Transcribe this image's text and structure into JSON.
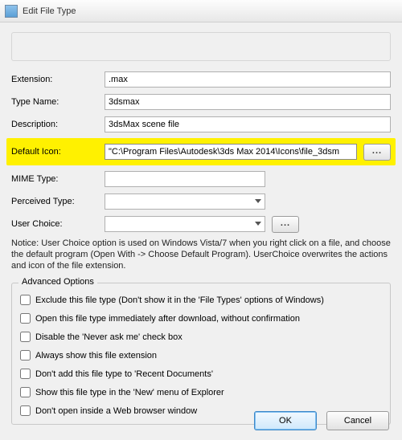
{
  "window": {
    "title": "Edit File Type"
  },
  "fields": {
    "extension": {
      "label": "Extension:",
      "value": ".max"
    },
    "typeName": {
      "label": "Type Name:",
      "value": "3dsmax"
    },
    "description": {
      "label": "Description:",
      "value": "3dsMax scene file"
    },
    "defaultIcon": {
      "label": "Default Icon:",
      "value": "\"C:\\Program Files\\Autodesk\\3ds Max 2014\\Icons\\file_3dsm",
      "browse": "..."
    },
    "mimeType": {
      "label": "MIME Type:",
      "value": ""
    },
    "perceivedType": {
      "label": "Perceived Type:",
      "value": ""
    },
    "userChoice": {
      "label": "User Choice:",
      "value": "",
      "browse": "..."
    }
  },
  "notice": "Notice: User Choice option is used on Windows Vista/7 when you right click on a file, and choose the default program (Open With -> Choose Default Program). UserChoice overwrites the actions and icon of the file extension.",
  "advanced": {
    "legend": "Advanced Options",
    "options": [
      "Exclude  this file type (Don't show it in the 'File Types' options of Windows)",
      "Open this file type immediately after download, without confirmation",
      "Disable the 'Never ask me' check box",
      "Always show this file extension",
      "Don't add this file type to 'Recent Documents'",
      "Show this file type in the 'New' menu of Explorer",
      "Don't open inside a Web browser window"
    ]
  },
  "buttons": {
    "ok": "OK",
    "cancel": "Cancel"
  }
}
